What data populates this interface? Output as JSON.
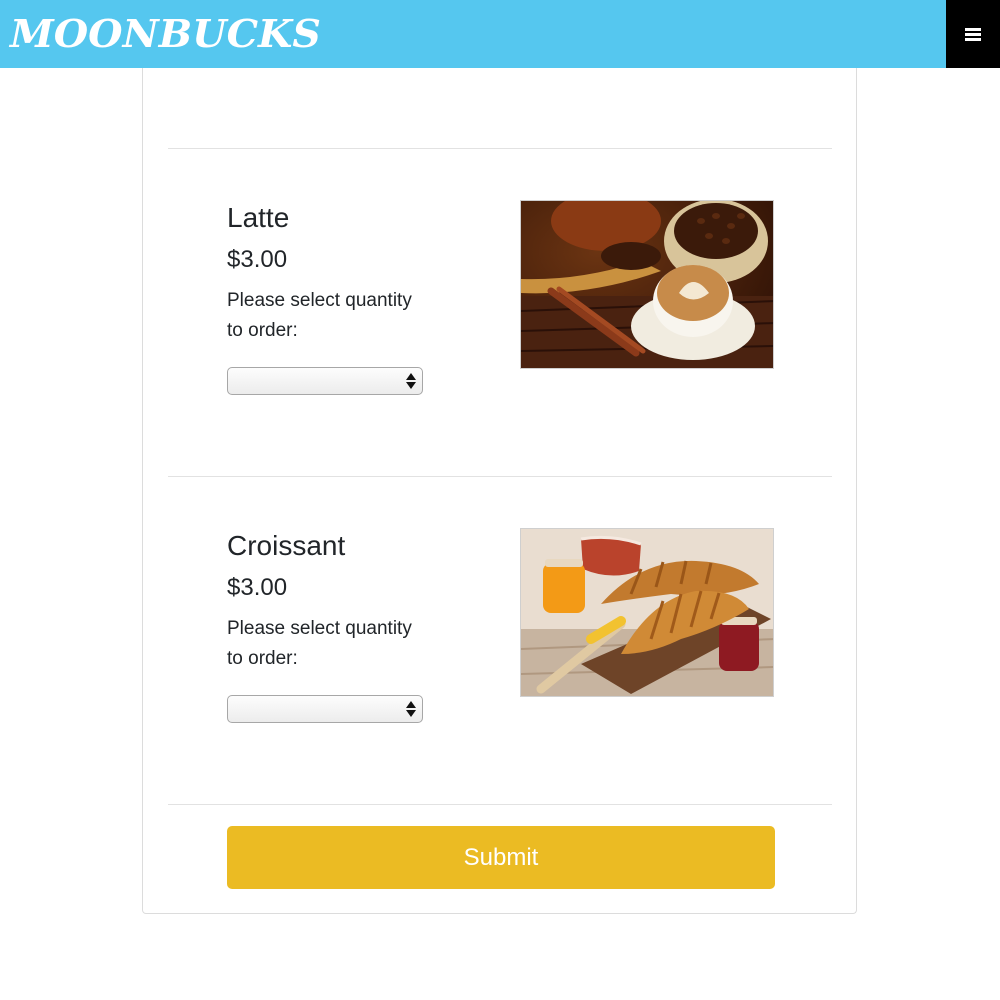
{
  "header": {
    "brand": "MOONBUCKS",
    "menu_icon": "hamburger-menu-icon",
    "colors": {
      "bar": "#55c7ef",
      "menu_button": "#000000"
    }
  },
  "items": [
    {
      "name": "Latte",
      "price": "$3.00",
      "prompt": "Please select quantity to order:",
      "quantity_selected": "",
      "image": "latte-coffee-photo"
    },
    {
      "name": "Croissant",
      "price": "$3.00",
      "prompt": "Please select quantity to order:",
      "quantity_selected": "",
      "image": "croissant-photo"
    }
  ],
  "form": {
    "submit_label": "Submit",
    "submit_color": "#ebbb23"
  }
}
